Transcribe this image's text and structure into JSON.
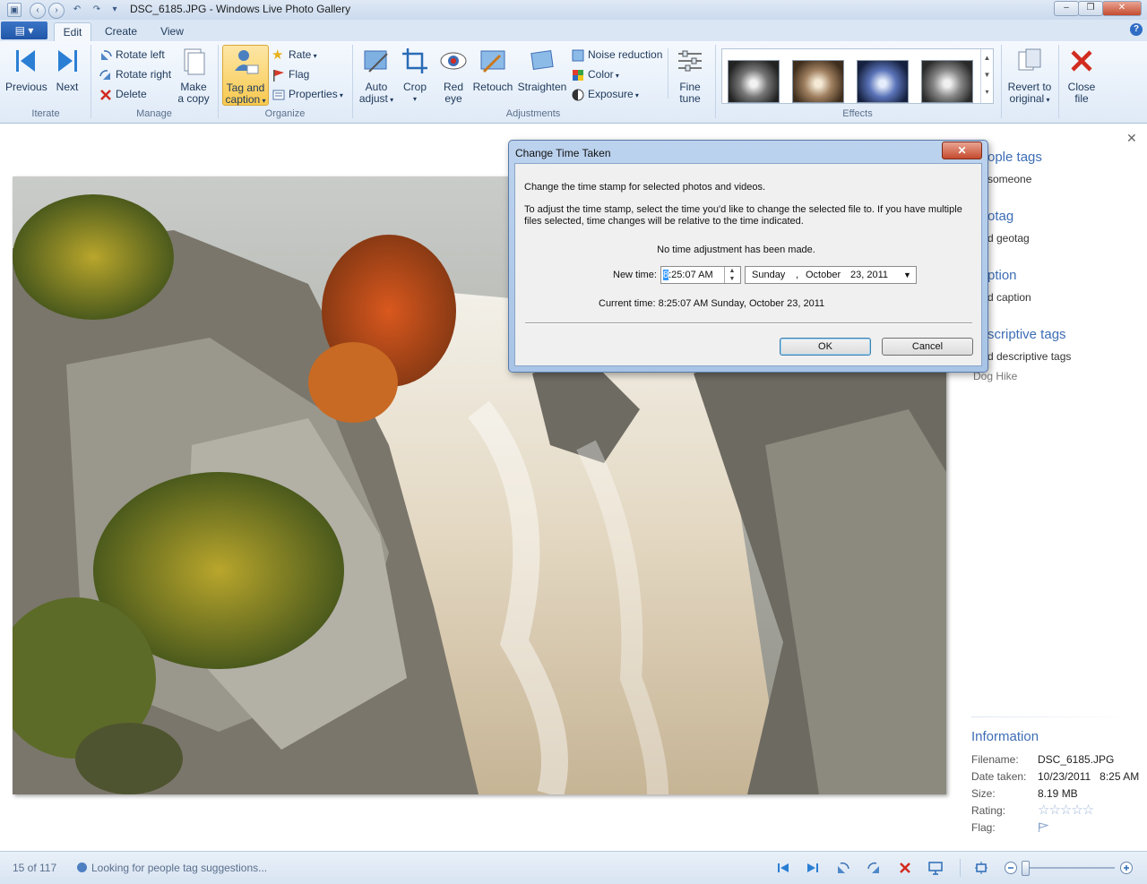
{
  "window": {
    "title": "DSC_6185.JPG - Windows Live Photo Gallery"
  },
  "tabs": [
    {
      "label": "Edit"
    },
    {
      "label": "Create"
    },
    {
      "label": "View"
    }
  ],
  "ribbon": {
    "iterate": {
      "label": "Iterate",
      "previous": "Previous",
      "next": "Next"
    },
    "manage": {
      "label": "Manage",
      "rotate_left": "Rotate left",
      "rotate_right": "Rotate right",
      "delete": "Delete",
      "make_copy_1": "Make",
      "make_copy_2": "a copy"
    },
    "organize": {
      "label": "Organize",
      "tag_caption_1": "Tag and",
      "tag_caption_2": "caption",
      "rate": "Rate",
      "flag": "Flag",
      "properties": "Properties"
    },
    "adjustments": {
      "label": "Adjustments",
      "auto_adjust_1": "Auto",
      "auto_adjust_2": "adjust",
      "crop": "Crop",
      "red_eye_1": "Red",
      "red_eye_2": "eye",
      "retouch": "Retouch",
      "straighten": "Straighten",
      "noise_reduction": "Noise reduction",
      "color": "Color",
      "exposure": "Exposure",
      "fine_tune_1": "Fine",
      "fine_tune_2": "tune"
    },
    "effects": {
      "label": "Effects"
    },
    "revert_1": "Revert to",
    "revert_2": "original",
    "close_1": "Close",
    "close_2": "file"
  },
  "side_pane": {
    "people_tags": "ople tags",
    "tag_someone": "someone",
    "geotag": "otag",
    "add_geotag": "d geotag",
    "caption": "ption",
    "add_caption": "d caption",
    "descriptive_tags": "scriptive tags",
    "add_descriptive_tags": "d descriptive tags",
    "dog_hike": "Dog Hike",
    "information": "Information",
    "info": [
      {
        "label": "Filename:",
        "value": "DSC_6185.JPG"
      },
      {
        "label": "Date taken:",
        "value": "10/23/2011   8:25 AM"
      },
      {
        "label": "Size:",
        "value": "8.19 MB"
      },
      {
        "label": "Rating:",
        "value": ""
      },
      {
        "label": "Flag:",
        "value": ""
      }
    ],
    "rating_stars": "☆☆☆☆☆"
  },
  "dialog": {
    "title": "Change Time Taken",
    "intro": "Change the time stamp for selected photos and videos.",
    "explain_1": "To adjust the time stamp, select the time you'd like to change the selected file to. If you have multiple",
    "explain_2": "files selected, time changes will be relative to the time indicated.",
    "status": "No time adjustment has been made.",
    "new_time_label": "New time:",
    "time_hour": "8",
    "time_rest": ":25:07 AM",
    "date_weekday": "Sunday",
    "date_comma": ",",
    "date_month": "October",
    "date_day": "23, 2011",
    "current_time": "Current time: 8:25:07 AM Sunday, October 23, 2011",
    "ok": "OK",
    "cancel": "Cancel"
  },
  "status_bar": {
    "position": "15 of 117",
    "message": "Looking for people tag suggestions..."
  },
  "colors": {
    "accent": "#3d6db5",
    "ribbon_bg": "#dfeaf7",
    "selected_button": "#fbd67a"
  }
}
